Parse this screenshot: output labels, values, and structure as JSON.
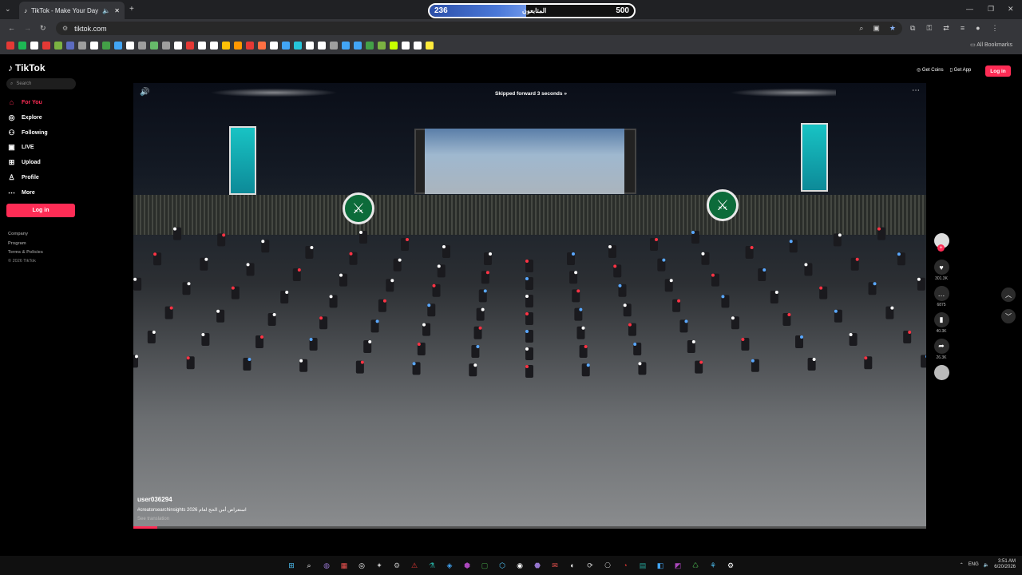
{
  "browser": {
    "tab_title": "TikTok - Make Your Day",
    "url": "tiktok.com",
    "all_bookmarks": "All Bookmarks",
    "bookmark_colors": [
      "#e53935",
      "#1db954",
      "#ffffff",
      "#e53935",
      "#7cb342",
      "#5c6bc0",
      "#9e9e9e",
      "#ffffff",
      "#43a047",
      "#42a5f5",
      "#ffffff",
      "#9e9e9e",
      "#66bb6a",
      "#9e9e9e",
      "#ffffff",
      "#e53935",
      "#ffffff",
      "#ffffff",
      "#ffc107",
      "#ff9800",
      "#e53935",
      "#ff7043",
      "#ffffff",
      "#42a5f5",
      "#26c6da",
      "#ffffff",
      "#ffffff",
      "#9e9e9e",
      "#42a5f5",
      "#42a5f5",
      "#43a047",
      "#7cb342",
      "#c6ff00",
      "#ffffff",
      "#ffffff",
      "#ffeb3b"
    ]
  },
  "follower_goal": {
    "current": "236",
    "label": "المتابعون",
    "goal": "500",
    "progress_fraction": 0.472
  },
  "sidebar": {
    "logo": "TikTok",
    "search_placeholder": "Search",
    "items": [
      {
        "label": "For You",
        "icon": "home-icon",
        "active": true
      },
      {
        "label": "Explore",
        "icon": "compass-icon",
        "active": false
      },
      {
        "label": "Following",
        "icon": "users-icon",
        "active": false
      },
      {
        "label": "LIVE",
        "icon": "live-icon",
        "active": false
      },
      {
        "label": "Upload",
        "icon": "upload-icon",
        "active": false
      },
      {
        "label": "Profile",
        "icon": "profile-icon",
        "active": false
      },
      {
        "label": "More",
        "icon": "more-icon",
        "active": false
      }
    ],
    "login": "Log in",
    "footer": [
      "Company",
      "Program",
      "Terms & Policies",
      "© 2026 TikTok"
    ]
  },
  "header": {
    "get_coins": "Get Coins",
    "get_app": "Get App",
    "login": "Log in"
  },
  "video": {
    "skip_notice": "Skipped forward 3 seconds",
    "username": "user036294",
    "description": "#creatorsearchinsights  استعراض أمن الحج لعام 2026",
    "see_translation": "See translation",
    "progress_fraction": 0.03
  },
  "actions": {
    "likes": "301.3K",
    "comments": "6875",
    "saves": "40.3K",
    "shares": "26.3K"
  },
  "taskbar": {
    "lang": "ENG",
    "time": "3:51 AM",
    "date": "6/20/2026"
  }
}
